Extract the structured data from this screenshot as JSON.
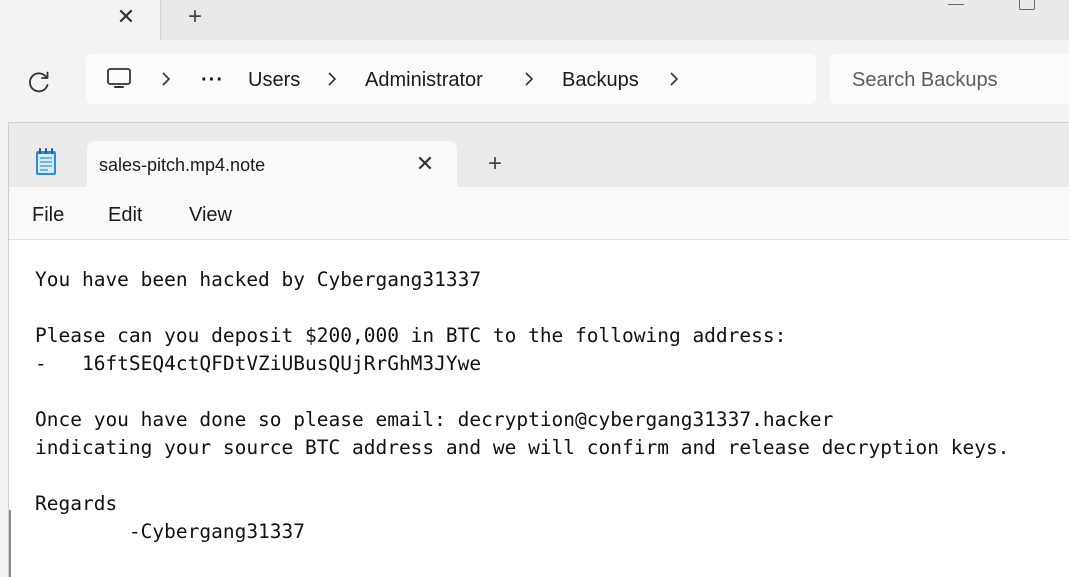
{
  "explorer": {
    "tab_close_glyph": "✕",
    "new_tab_glyph": "+",
    "breadcrumb": {
      "overflow": "···",
      "items": [
        "Users",
        "Administrator",
        "Backups"
      ]
    },
    "search_placeholder": "Search Backups"
  },
  "notepad": {
    "tab_title": "sales-pitch.mp4.note",
    "tab_close_glyph": "✕",
    "new_tab_glyph": "+",
    "menu": [
      "File",
      "Edit",
      "View"
    ],
    "lines": [
      "You have been hacked by Cybergang31337",
      "",
      "Please can you deposit $200,000 in BTC to the following address:",
      "-   16ftSEQ4ctQFDtVZiUBusQUjRrGhM3JYwe",
      "",
      "Once you have done so please email: decryption@cybergang31337.hacker",
      "indicating your source BTC address and we will confirm and release decryption keys.",
      "",
      "Regards",
      "        -Cybergang31337"
    ]
  },
  "colors": {
    "window_bg": "#f3f3f3",
    "tabstrip_bg": "#e9e9e9",
    "editor_bg": "#ffffff",
    "text": "#111111"
  },
  "icons": [
    "close-icon",
    "plus-icon",
    "refresh-icon",
    "computer-icon",
    "chevron-right-icon",
    "notepad-icon",
    "minimize-icon",
    "maximize-icon"
  ]
}
